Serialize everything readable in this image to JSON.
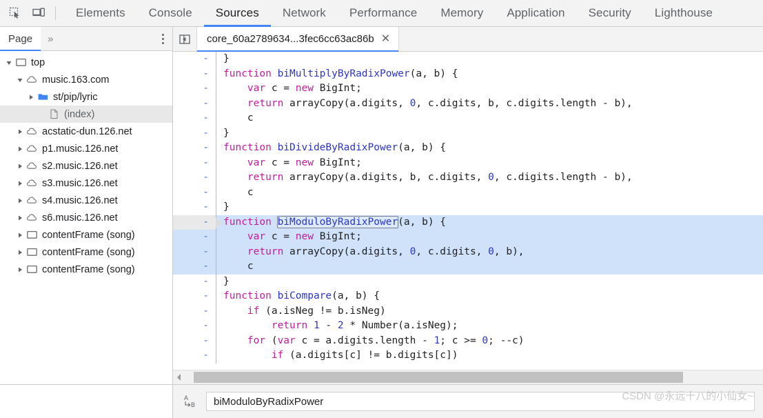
{
  "toolbar": {
    "inspect_icon": "inspect-element-icon",
    "device_icon": "device-toolbar-icon",
    "tabs": [
      {
        "label": "Elements",
        "active": false
      },
      {
        "label": "Console",
        "active": false
      },
      {
        "label": "Sources",
        "active": true
      },
      {
        "label": "Network",
        "active": false
      },
      {
        "label": "Performance",
        "active": false
      },
      {
        "label": "Memory",
        "active": false
      },
      {
        "label": "Application",
        "active": false
      },
      {
        "label": "Security",
        "active": false
      },
      {
        "label": "Lighthouse",
        "active": false
      }
    ]
  },
  "navigator": {
    "tab_label": "Page",
    "overflow_label": "»",
    "more_menu_icon": "more-vertical-icon",
    "tree": [
      {
        "label": "top",
        "icon": "frame-icon",
        "indent": 0,
        "twist": "open",
        "selected": false,
        "muted": false
      },
      {
        "label": "music.163.com",
        "icon": "cloud-icon",
        "indent": 1,
        "twist": "open",
        "selected": false,
        "muted": false
      },
      {
        "label": "st/pip/lyric",
        "icon": "folder-blue-icon",
        "indent": 2,
        "twist": "closed",
        "selected": false,
        "muted": false
      },
      {
        "label": "(index)",
        "icon": "document-icon",
        "indent": 3,
        "twist": "none",
        "selected": true,
        "muted": true
      },
      {
        "label": "acstatic-dun.126.net",
        "icon": "cloud-icon",
        "indent": 1,
        "twist": "closed",
        "selected": false,
        "muted": false
      },
      {
        "label": "p1.music.126.net",
        "icon": "cloud-icon",
        "indent": 1,
        "twist": "closed",
        "selected": false,
        "muted": false
      },
      {
        "label": "s2.music.126.net",
        "icon": "cloud-icon",
        "indent": 1,
        "twist": "closed",
        "selected": false,
        "muted": false
      },
      {
        "label": "s3.music.126.net",
        "icon": "cloud-icon",
        "indent": 1,
        "twist": "closed",
        "selected": false,
        "muted": false
      },
      {
        "label": "s4.music.126.net",
        "icon": "cloud-icon",
        "indent": 1,
        "twist": "closed",
        "selected": false,
        "muted": false
      },
      {
        "label": "s6.music.126.net",
        "icon": "cloud-icon",
        "indent": 1,
        "twist": "closed",
        "selected": false,
        "muted": false
      },
      {
        "label": "contentFrame (song)",
        "icon": "frame-icon",
        "indent": 1,
        "twist": "closed",
        "selected": false,
        "muted": false
      },
      {
        "label": "contentFrame (song)",
        "icon": "frame-icon",
        "indent": 1,
        "twist": "closed",
        "selected": false,
        "muted": false
      },
      {
        "label": "contentFrame (song)",
        "icon": "frame-icon",
        "indent": 1,
        "twist": "closed",
        "selected": false,
        "muted": false
      }
    ]
  },
  "editor": {
    "collapse_icon": "collapse-sidebar-icon",
    "file_tab_label": "core_60a2789634...3fec6cc63ac86b",
    "file_tab_close": "✕",
    "gutter_marker": "-",
    "lines": [
      {
        "sel": false,
        "exec": false,
        "tokens": [
          {
            "t": "}",
            "c": "ctext"
          }
        ],
        "indent": 0
      },
      {
        "sel": false,
        "exec": false,
        "tokens": [
          {
            "t": "function ",
            "c": "kw"
          },
          {
            "t": "biMultiplyByRadixPower",
            "c": "fn"
          },
          {
            "t": "(a, b) {",
            "c": "ctext"
          }
        ],
        "indent": 0
      },
      {
        "sel": false,
        "exec": false,
        "tokens": [
          {
            "t": "var ",
            "c": "kw"
          },
          {
            "t": "c = ",
            "c": "ctext"
          },
          {
            "t": "new ",
            "c": "kw"
          },
          {
            "t": "BigInt;",
            "c": "ctext"
          }
        ],
        "indent": 1
      },
      {
        "sel": false,
        "exec": false,
        "tokens": [
          {
            "t": "return ",
            "c": "kw"
          },
          {
            "t": "arrayCopy(a.digits, ",
            "c": "ctext"
          },
          {
            "t": "0",
            "c": "num"
          },
          {
            "t": ", c.digits, b, c.digits.length - b),",
            "c": "ctext"
          }
        ],
        "indent": 1
      },
      {
        "sel": false,
        "exec": false,
        "tokens": [
          {
            "t": "c",
            "c": "ctext"
          }
        ],
        "indent": 1
      },
      {
        "sel": false,
        "exec": false,
        "tokens": [
          {
            "t": "}",
            "c": "ctext"
          }
        ],
        "indent": 0
      },
      {
        "sel": false,
        "exec": false,
        "tokens": [
          {
            "t": "function ",
            "c": "kw"
          },
          {
            "t": "biDivideByRadixPower",
            "c": "fn"
          },
          {
            "t": "(a, b) {",
            "c": "ctext"
          }
        ],
        "indent": 0
      },
      {
        "sel": false,
        "exec": false,
        "tokens": [
          {
            "t": "var ",
            "c": "kw"
          },
          {
            "t": "c = ",
            "c": "ctext"
          },
          {
            "t": "new ",
            "c": "kw"
          },
          {
            "t": "BigInt;",
            "c": "ctext"
          }
        ],
        "indent": 1
      },
      {
        "sel": false,
        "exec": false,
        "tokens": [
          {
            "t": "return ",
            "c": "kw"
          },
          {
            "t": "arrayCopy(a.digits, b, c.digits, ",
            "c": "ctext"
          },
          {
            "t": "0",
            "c": "num"
          },
          {
            "t": ", c.digits.length - b),",
            "c": "ctext"
          }
        ],
        "indent": 1
      },
      {
        "sel": false,
        "exec": false,
        "tokens": [
          {
            "t": "c",
            "c": "ctext"
          }
        ],
        "indent": 1
      },
      {
        "sel": false,
        "exec": false,
        "tokens": [
          {
            "t": "}",
            "c": "ctext"
          }
        ],
        "indent": 0
      },
      {
        "sel": true,
        "exec": true,
        "tokens": [
          {
            "t": "function ",
            "c": "kw"
          },
          {
            "t": "biModuloByRadixPower",
            "c": "fn boxed"
          },
          {
            "t": "(a, b) {",
            "c": "ctext"
          }
        ],
        "indent": 0
      },
      {
        "sel": true,
        "exec": false,
        "tokens": [
          {
            "t": "var ",
            "c": "kw"
          },
          {
            "t": "c = ",
            "c": "ctext"
          },
          {
            "t": "new ",
            "c": "kw"
          },
          {
            "t": "BigInt;",
            "c": "ctext"
          }
        ],
        "indent": 1
      },
      {
        "sel": true,
        "exec": false,
        "tokens": [
          {
            "t": "return ",
            "c": "kw"
          },
          {
            "t": "arrayCopy(a.digits, ",
            "c": "ctext"
          },
          {
            "t": "0",
            "c": "num"
          },
          {
            "t": ", c.digits, ",
            "c": "ctext"
          },
          {
            "t": "0",
            "c": "num"
          },
          {
            "t": ", b),",
            "c": "ctext"
          }
        ],
        "indent": 1
      },
      {
        "sel": true,
        "exec": false,
        "tokens": [
          {
            "t": "c",
            "c": "ctext"
          }
        ],
        "indent": 1
      },
      {
        "sel": false,
        "exec": false,
        "tokens": [
          {
            "t": "}",
            "c": "ctext"
          }
        ],
        "indent": 0
      },
      {
        "sel": false,
        "exec": false,
        "tokens": [
          {
            "t": "function ",
            "c": "kw"
          },
          {
            "t": "biCompare",
            "c": "fn"
          },
          {
            "t": "(a, b) {",
            "c": "ctext"
          }
        ],
        "indent": 0
      },
      {
        "sel": false,
        "exec": false,
        "tokens": [
          {
            "t": "if ",
            "c": "kw"
          },
          {
            "t": "(a.isNeg != b.isNeg)",
            "c": "ctext"
          }
        ],
        "indent": 1
      },
      {
        "sel": false,
        "exec": false,
        "tokens": [
          {
            "t": "return ",
            "c": "kw"
          },
          {
            "t": "1",
            "c": "num"
          },
          {
            "t": " - ",
            "c": "ctext"
          },
          {
            "t": "2",
            "c": "num"
          },
          {
            "t": " * Number(a.isNeg);",
            "c": "ctext"
          }
        ],
        "indent": 2
      },
      {
        "sel": false,
        "exec": false,
        "tokens": [
          {
            "t": "for ",
            "c": "kw"
          },
          {
            "t": "(",
            "c": "ctext"
          },
          {
            "t": "var ",
            "c": "kw"
          },
          {
            "t": "c = a.digits.length - ",
            "c": "ctext"
          },
          {
            "t": "1",
            "c": "num"
          },
          {
            "t": "; c >= ",
            "c": "ctext"
          },
          {
            "t": "0",
            "c": "num"
          },
          {
            "t": "; --c)",
            "c": "ctext"
          }
        ],
        "indent": 1
      },
      {
        "sel": false,
        "exec": false,
        "tokens": [
          {
            "t": "if ",
            "c": "kw"
          },
          {
            "t": "(a.digits[c] != b.digits[c])",
            "c": "ctext"
          }
        ],
        "indent": 2
      }
    ]
  },
  "scrollbar": {
    "left_arrow": "scroll-left-arrow"
  },
  "statusbar": {
    "format_icon": "pretty-print-icon",
    "format_icon_top": "A",
    "format_icon_bottom": "B",
    "search_value": "biModuloByRadixPower",
    "search_placeholder": "",
    "watermark": "CSDN @永远十八的小仙女~"
  },
  "colors": {
    "accent": "#4285f4",
    "keyword": "#c41a9e",
    "function": "#2b35c8",
    "selection": "#cfe2f9",
    "gutter_text": "#4a6fd4"
  }
}
